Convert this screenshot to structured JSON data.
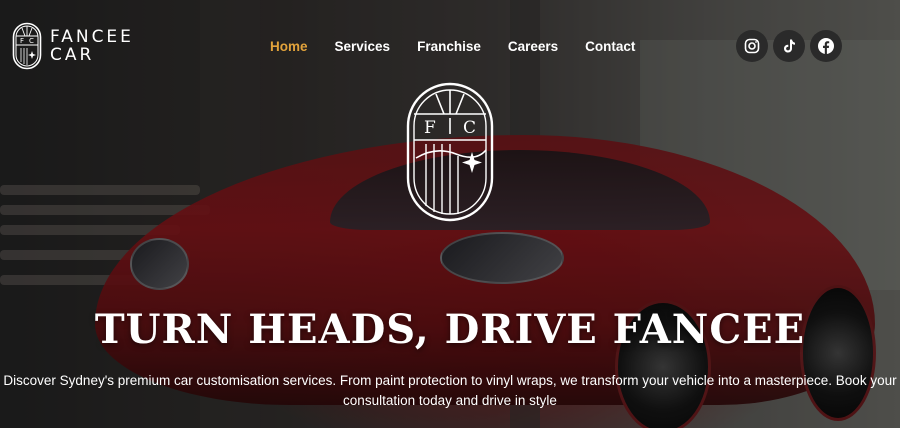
{
  "brand": {
    "logo_line1": "FANCEE",
    "logo_line2": "CAR",
    "logo_letters": [
      "F",
      "C"
    ]
  },
  "nav": {
    "items": [
      {
        "label": "Home",
        "active": true
      },
      {
        "label": "Services",
        "active": false
      },
      {
        "label": "Franchise",
        "active": false
      },
      {
        "label": "Careers",
        "active": false
      },
      {
        "label": "Contact",
        "active": false
      }
    ],
    "active_color": "#e2a33b"
  },
  "social": [
    "instagram-icon",
    "tiktok-icon",
    "facebook-icon"
  ],
  "emblem": {
    "letters": [
      "F",
      "C"
    ]
  },
  "hero": {
    "headline": "TURN HEADS, DRIVE FANCEE",
    "description": "Discover Sydney's premium car customisation services. From paint protection to vinyl wraps, we transform your vehicle into a masterpiece. Book your consultation today and drive in style"
  }
}
